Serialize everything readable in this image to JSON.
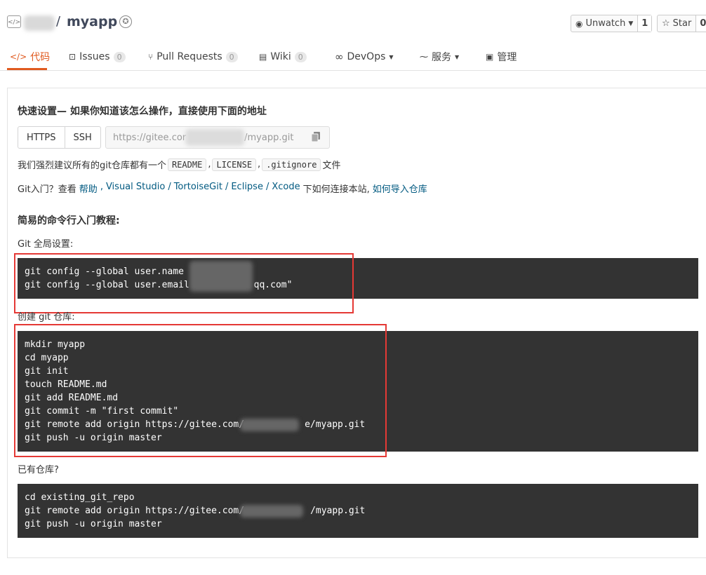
{
  "header": {
    "repo_name": "myapp",
    "slash": "/",
    "watch_label": "Unwatch",
    "watch_count": "1",
    "star_label": "Star",
    "star_count": "0"
  },
  "tabs": [
    {
      "label": "代码",
      "badge": null
    },
    {
      "label": "Issues",
      "badge": "0"
    },
    {
      "label": "Pull Requests",
      "badge": "0"
    },
    {
      "label": "Wiki",
      "badge": "0"
    },
    {
      "label": "DevOps",
      "badge": null
    },
    {
      "label": "服务",
      "badge": null
    },
    {
      "label": "管理",
      "badge": null
    }
  ],
  "quick_setup": {
    "title": "快速设置— 如果你知道该怎么操作，直接使用下面的地址",
    "https_label": "HTTPS",
    "ssh_label": "SSH",
    "url_prefix": "https://gitee.cor",
    "url_suffix": "/myapp.git"
  },
  "recommend": {
    "prefix": "我们强烈建议所有的git仓库都有一个",
    "files": [
      "README",
      "LICENSE",
      ".gitignore"
    ],
    "sep": ",",
    "suffix": "文件"
  },
  "intro": {
    "prefix": "Git入门？查看",
    "help": "帮助",
    "comma": ",",
    "tools": [
      "Visual Studio",
      "TortoiseGit",
      "Eclipse",
      "Xcode"
    ],
    "tool_sep": "/",
    "suffix": "下如何连接本站,",
    "import_link": "如何导入仓库"
  },
  "tutorial": {
    "title": "简易的命令行入门教程:",
    "global_label": "Git 全局设置:",
    "global_code": [
      "git config --global user.name",
      "git config --global user.email "
    ],
    "global_email_tail": "qq.com\"",
    "create_label": "创建 git 仓库:",
    "create_code": [
      "mkdir myapp",
      "cd myapp",
      "git init",
      "touch README.md",
      "git add README.md",
      "git commit -m \"first commit\"",
      "git remote add origin https://gitee.com/",
      "git push -u origin master"
    ],
    "create_remote_tail": "e/myapp.git",
    "existing_label": "已有仓库?",
    "existing_code": [
      "cd existing_git_repo",
      "git remote add origin https://gitee.com/",
      "git push -u origin master"
    ],
    "existing_remote_tail": "/myapp.git"
  },
  "colors": {
    "accent": "#e05a1f",
    "link": "#005980",
    "code_bg": "#333333",
    "annotation_red": "#e53935"
  }
}
